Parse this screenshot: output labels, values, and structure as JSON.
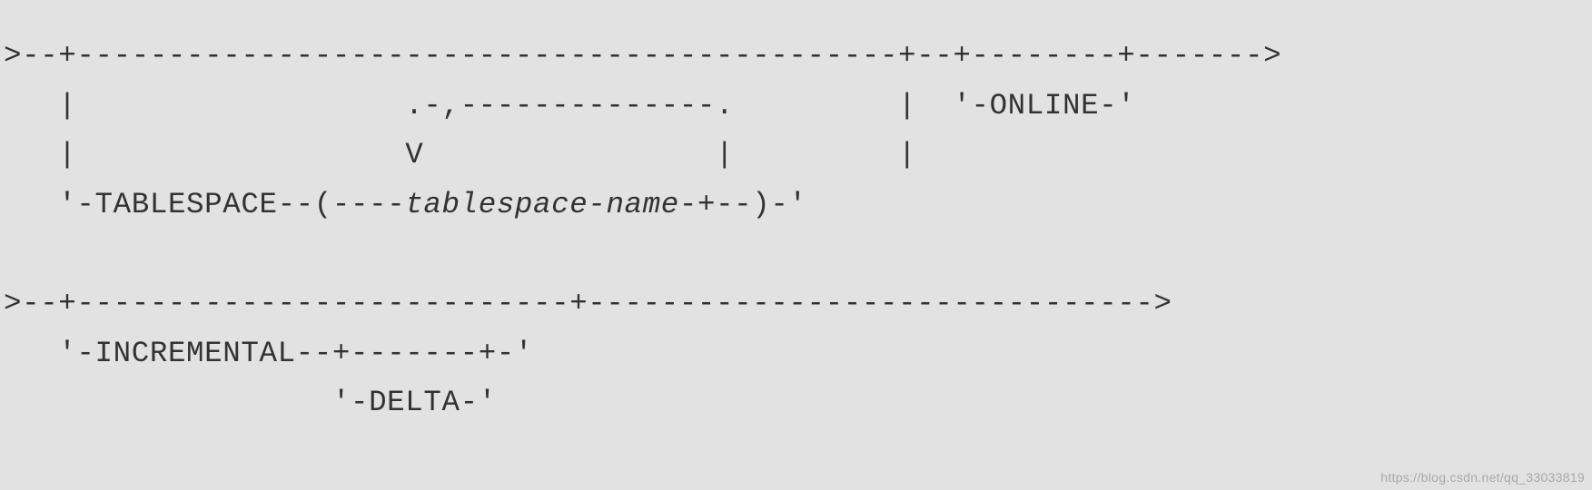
{
  "diagram": {
    "line1": ">--+---------------------------------------------+--+--------+------->",
    "line2": "   |                  .-,--------------.         |  '-",
    "line2_online": "ONLINE",
    "line2_end": "-'",
    "line3": "   |                  V                |         |",
    "line4_a": "   '-",
    "line4_tablespace": "TABLESPACE",
    "line4_b": "--(----",
    "line4_param": "tablespace-name",
    "line4_c": "-+--)-'",
    "line5": "",
    "line6": ">--+---------------------------+------------------------------->",
    "line7_a": "   '-",
    "line7_incremental": "INCREMENTAL",
    "line7_b": "--+-------+-'",
    "line8_a": "                  '-",
    "line8_delta": "DELTA",
    "line8_b": "-'"
  },
  "watermark": "https://blog.csdn.net/qq_33033819"
}
